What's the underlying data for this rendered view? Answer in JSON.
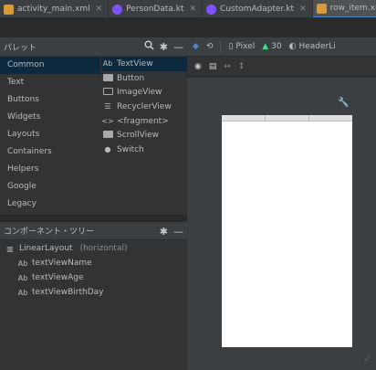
{
  "tabs": [
    {
      "label": "activity_main.xml",
      "kind": "xml"
    },
    {
      "label": "PersonData.kt",
      "kind": "kt"
    },
    {
      "label": "CustomAdapter.kt",
      "kind": "kt"
    },
    {
      "label": "row_item.xml",
      "kind": "xml",
      "active": true
    }
  ],
  "palette": {
    "title": "パレット",
    "categories": [
      "Common",
      "Text",
      "Buttons",
      "Widgets",
      "Layouts",
      "Containers",
      "Helpers",
      "Google",
      "Legacy"
    ],
    "items": [
      {
        "icon": "Ab",
        "label": "TextView"
      },
      {
        "icon": "button-icon",
        "label": "Button"
      },
      {
        "icon": "imageview-icon",
        "label": "ImageView"
      },
      {
        "icon": "recyclerview-icon",
        "label": "RecyclerView"
      },
      {
        "icon": "<>",
        "label": "<fragment>"
      },
      {
        "icon": "scrollview-icon",
        "label": "ScrollView"
      },
      {
        "icon": "switch-icon",
        "label": "Switch"
      }
    ]
  },
  "tree": {
    "title": "コンポーネント・ツリー",
    "root": {
      "label": "LinearLayout",
      "note": "(horizontal)"
    },
    "children": [
      {
        "icon": "Ab",
        "label": "textViewName"
      },
      {
        "icon": "Ab",
        "label": "textViewAge"
      },
      {
        "icon": "Ab",
        "label": "textViewBirthDay"
      }
    ]
  },
  "design_toolbar": {
    "device": "Pixel",
    "api": "30",
    "layout": "HeaderLi"
  },
  "colors": {
    "accent": "#4a88c7",
    "selection": "#0d293e",
    "android_green": "#3ddc84"
  }
}
